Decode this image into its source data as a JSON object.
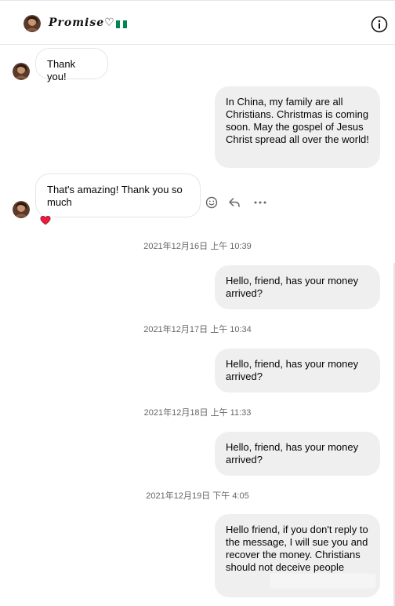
{
  "header": {
    "contact_name": "Promise♡",
    "flag_colors": [
      "#008751",
      "#ffffff",
      "#008751"
    ],
    "info_icon": "info-icon"
  },
  "messages": [
    {
      "direction": "in",
      "text": "Thank you!"
    },
    {
      "direction": "out",
      "text": "In China, my family are all Christians. Christmas is coming soon. May the gospel of Jesus Christ spread all over the world!"
    },
    {
      "direction": "in",
      "text": "That's amazing! Thank you so much",
      "reaction": "heart"
    },
    {
      "direction": "out",
      "text": "Hello, friend, has your money arrived?"
    },
    {
      "direction": "out",
      "text": "Hello, friend, has your money arrived?"
    },
    {
      "direction": "out",
      "text": "Hello, friend, has your money arrived?"
    },
    {
      "direction": "out",
      "text": "Hello friend, if you don't reply to the message, I will sue you and recover the money. Christians should not deceive people"
    }
  ],
  "timestamps": [
    "2021年12月16日 上午 10:39",
    "2021年12月17日 上午 10:34",
    "2021年12月18日 上午 11:33",
    "2021年12月19日 下午 4:05"
  ],
  "hover_actions": [
    "react-icon",
    "reply-icon",
    "more-icon"
  ],
  "colors": {
    "outgoing_bubble": "#efefef",
    "incoming_border": "#e4e6eb",
    "timestamp_text": "#65676b",
    "reaction_heart": "#e41e3f"
  }
}
